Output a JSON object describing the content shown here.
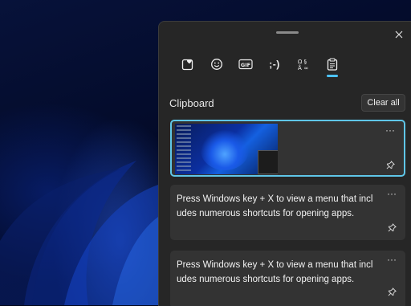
{
  "panel": {
    "tabs": [
      {
        "name": "Emoji",
        "icon": "emoji-heart-icon"
      },
      {
        "name": "Kaomoji smiley",
        "icon": "smiley-icon"
      },
      {
        "name": "GIF",
        "icon": "gif-icon",
        "label": "GIF"
      },
      {
        "name": "Kaomoji",
        "icon": "kaomoji-icon",
        "label": ";-)"
      },
      {
        "name": "Symbols",
        "icon": "symbols-icon"
      },
      {
        "name": "Clipboard",
        "icon": "clipboard-icon",
        "active": true
      }
    ],
    "section_title": "Clipboard",
    "clear_all_label": "Clear all",
    "items": [
      {
        "type": "image",
        "description_icon": "screenshot-thumbnail"
      },
      {
        "type": "text",
        "text": "Press Windows key + X to view a menu that includes numerous shortcuts for opening apps."
      },
      {
        "type": "text",
        "text": "Press Windows key + X to view a menu that includes numerous shortcuts for opening apps."
      }
    ],
    "more_label": "···"
  },
  "colors": {
    "accent": "#4cc2ff",
    "panel_bg": "#262626",
    "item_bg": "#333333",
    "selected_border": "#5fc6e8"
  }
}
